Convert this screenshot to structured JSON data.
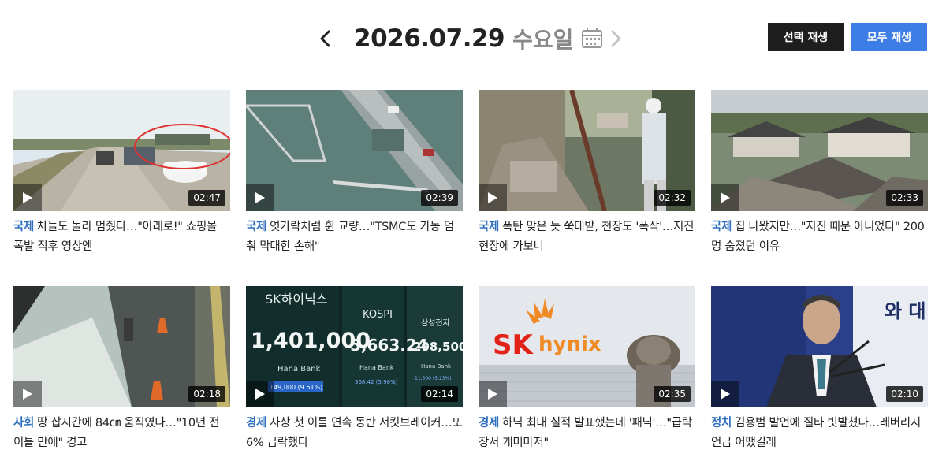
{
  "header": {
    "date": "2026.07.29",
    "weekday": "수요일",
    "prev_icon": "chevron-left-icon",
    "next_icon": "chevron-right-icon",
    "calendar_icon": "calendar-icon",
    "select_play_label": "선택 재생",
    "play_all_label": "모두 재생",
    "colors": {
      "select_button": "#1e1e1e",
      "play_all_button": "#3d7de6",
      "category": "#2f6fbf"
    }
  },
  "videos": [
    {
      "category": "국제",
      "title": "차들도 놀라 멈췄다…\"아래로!\" 쇼핑몰 폭발 직후 영상엔",
      "duration": "02:47"
    },
    {
      "category": "국제",
      "title": "엿가락처럼 휜 교량…\"TSMC도 가동 멈춰 막대한 손해\"",
      "duration": "02:39"
    },
    {
      "category": "국제",
      "title": "폭탄 맞은 듯 쑥대밭, 천장도 '폭삭'…지진 현장에 가보니",
      "duration": "02:32"
    },
    {
      "category": "국제",
      "title": "집 나왔지만…\"지진 때문 아니었다\" 200명 숨졌던 이유",
      "duration": "02:33"
    },
    {
      "category": "사회",
      "title": "땅 삽시간에 84㎝ 움직였다…\"10년 전 이틀 만에\" 경고",
      "duration": "02:18"
    },
    {
      "category": "경제",
      "title": "사상 첫 이틀 연속 동반 서킷브레이커…또 6% 급락했다",
      "duration": "02:14"
    },
    {
      "category": "경제",
      "title": "하닉 최대 실적 발표했는데 '패닉'…\"급락장서 개미마저\"",
      "duration": "02:35"
    },
    {
      "category": "정치",
      "title": "김용범 발언에 질타 빗발쳤다…레버리지 언급 어땠길래",
      "duration": "02:10"
    }
  ],
  "thumbnails": {
    "stock_board": {
      "sk_label": "SK하이닉스",
      "sk_value": "1,401,000",
      "sk_bank": "Hana Bank",
      "sk_change": "149,000 (9.61%)",
      "kospi_label": "KOSPI",
      "kospi_value": "5,663.24",
      "kospi_bank": "Hana Bank",
      "kospi_change": "368.42 (5.98%)",
      "samsung_label": "삼성전자",
      "samsung_value": "208,500",
      "samsung_bank": "Hana Bank",
      "samsung_change": "11,500 (5.23%)"
    },
    "logo": {
      "sk": "SK",
      "hynix": "hynix"
    },
    "podium_sign": "와 대"
  }
}
